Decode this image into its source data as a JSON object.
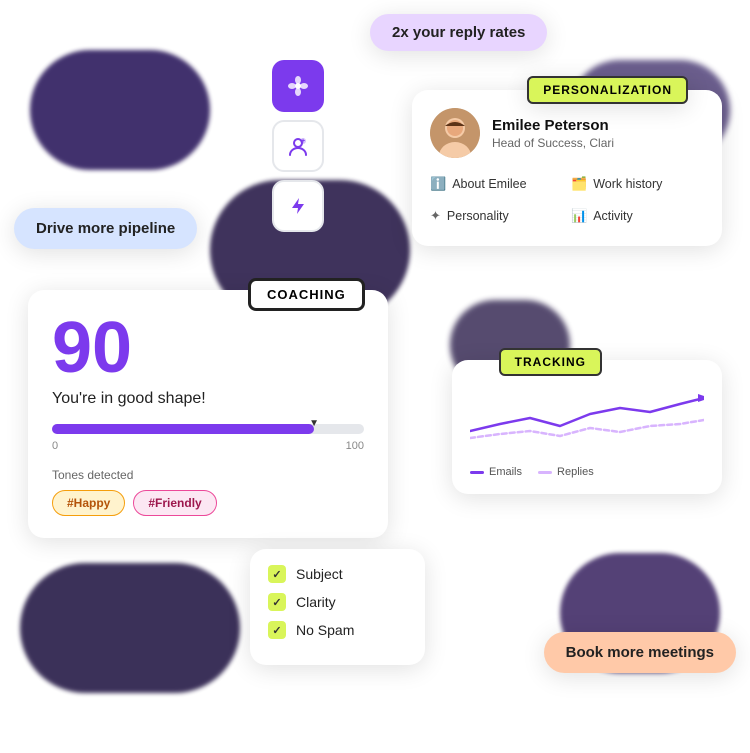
{
  "bubbles": {
    "reply": "2x your reply rates",
    "pipeline": "Drive more pipeline",
    "meetings": "Book more meetings"
  },
  "badges": {
    "personalization": "PERSONALIZATION",
    "coaching": "COACHING",
    "tracking": "TRACKING"
  },
  "person": {
    "name": "Emilee Peterson",
    "title": "Head of Success, Clari",
    "info": [
      {
        "icon": "ℹ",
        "label": "About Emilee"
      },
      {
        "icon": "🗂",
        "label": "Work history"
      },
      {
        "icon": "✦",
        "label": "Personality"
      },
      {
        "icon": "📊",
        "label": "Activity"
      }
    ]
  },
  "coaching": {
    "score": "90",
    "status": "You're in good shape!",
    "progress_min": "0",
    "progress_max": "100",
    "tones_label": "Tones detected",
    "tones": [
      "#Happy",
      "#Friendly"
    ]
  },
  "checklist": {
    "items": [
      "Subject",
      "Clarity",
      "No Spam"
    ]
  },
  "tracking": {
    "legend": [
      {
        "label": "Emails",
        "color": "#7c3aed"
      },
      {
        "label": "Replies",
        "color": "#d8b4fe"
      }
    ]
  }
}
